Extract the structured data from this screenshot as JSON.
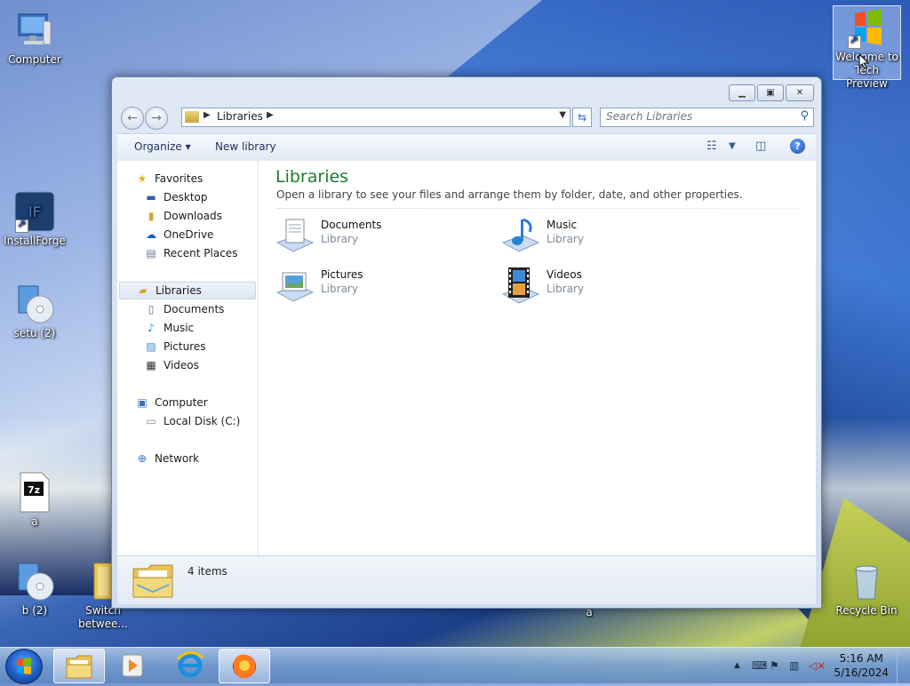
{
  "desktop": {
    "icons": [
      {
        "label": "Computer"
      },
      {
        "label": "Welcome to Tech Preview"
      },
      {
        "label": "InstallForge"
      },
      {
        "label": "setu (2)"
      },
      {
        "label": "a"
      },
      {
        "label": "b (2)"
      },
      {
        "label": "Switch betwee..."
      },
      {
        "label": "a"
      },
      {
        "label": "Recycle Bin"
      }
    ]
  },
  "window": {
    "address": {
      "crumb": "Libraries"
    },
    "search": {
      "placeholder": "Search Libraries"
    },
    "toolbar": {
      "organize": "Organize",
      "new_library": "New library"
    },
    "nav": {
      "favorites": "Favorites",
      "favorites_items": [
        "Desktop",
        "Downloads",
        "OneDrive",
        "Recent Places"
      ],
      "libraries": "Libraries",
      "libraries_items": [
        "Documents",
        "Music",
        "Pictures",
        "Videos"
      ],
      "computer": "Computer",
      "computer_items": [
        "Local Disk (C:)"
      ],
      "network": "Network"
    },
    "main": {
      "title": "Libraries",
      "description": "Open a library to see your files and arrange them by folder, date, and other properties.",
      "libraries": [
        {
          "name": "Documents",
          "type": "Library"
        },
        {
          "name": "Music",
          "type": "Library"
        },
        {
          "name": "Pictures",
          "type": "Library"
        },
        {
          "name": "Videos",
          "type": "Library"
        }
      ]
    },
    "status": {
      "count": "4 items"
    }
  },
  "taskbar": {
    "clock": {
      "time": "5:16 AM",
      "date": "5/16/2024"
    }
  }
}
